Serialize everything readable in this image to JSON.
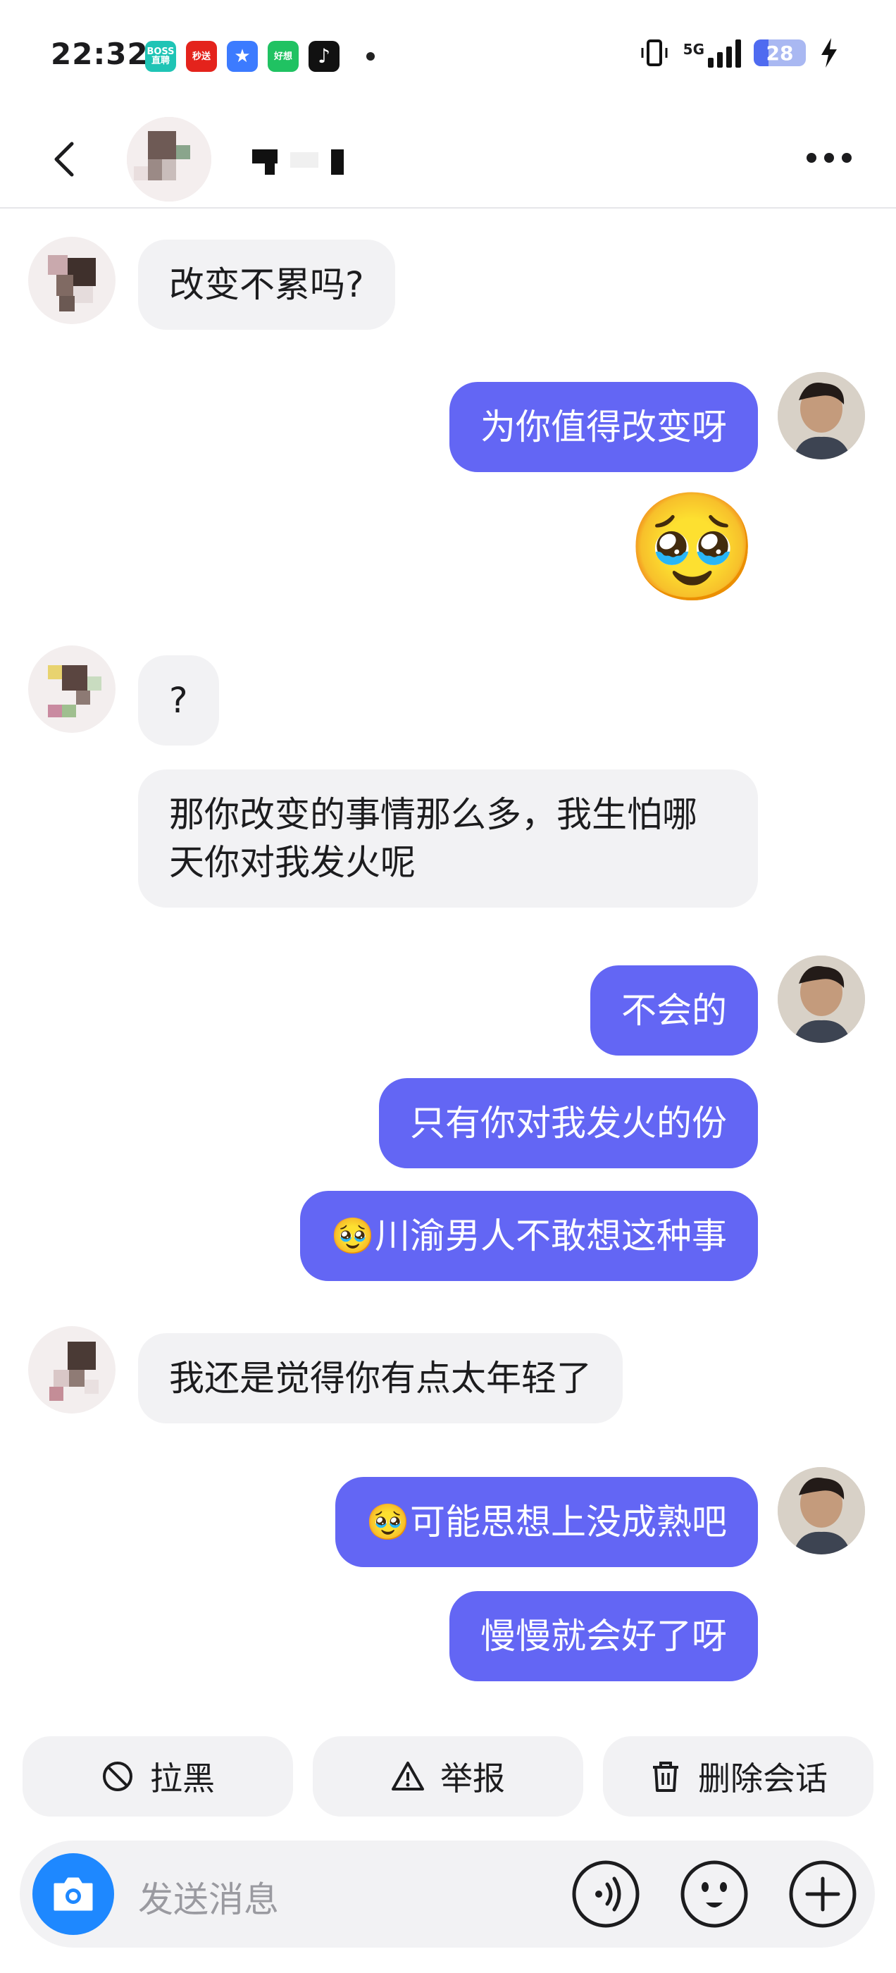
{
  "status_bar": {
    "time": "22:32",
    "network": "5G",
    "battery": "28",
    "battery_level": 0.28,
    "apps": [
      {
        "icon": "boss-zhipin-icon",
        "label": "BOSS直聘",
        "color": "#1fc4b5"
      },
      {
        "icon": "miaosong-icon",
        "label": "秒送",
        "color": "#e4231c"
      },
      {
        "icon": "star-app-icon",
        "label": "",
        "color": "#3c7bff"
      },
      {
        "icon": "haoxiang-icon",
        "label": "好想",
        "color": "#20c262"
      },
      {
        "icon": "douyin-icon",
        "label": "",
        "color": "#111111"
      }
    ]
  },
  "header": {
    "back_icon": "chevron-left-icon",
    "more_icon": "more-dots-icon"
  },
  "messages": [
    {
      "side": "in",
      "text": "改变不累吗?"
    },
    {
      "side": "out",
      "text": "为你值得改变呀"
    },
    {
      "side": "out",
      "emoji": "🥹",
      "text": ""
    },
    {
      "side": "in",
      "text": "?"
    },
    {
      "side": "in",
      "text": "那你改变的事情那么多，我生怕哪天你对我发火呢"
    },
    {
      "side": "out",
      "text": "不会的"
    },
    {
      "side": "out",
      "text": "只有你对我发火的份"
    },
    {
      "side": "out",
      "text": "🥹川渝男人不敢想这种事"
    },
    {
      "side": "in",
      "text": "我还是觉得你有点太年轻了"
    },
    {
      "side": "out",
      "text": "🥹可能思想上没成熟吧"
    },
    {
      "side": "out",
      "text": "慢慢就会好了呀"
    }
  ],
  "actions": {
    "block": {
      "label": "拉黑",
      "icon": "block-icon"
    },
    "report": {
      "label": "举报",
      "icon": "warning-icon"
    },
    "delete": {
      "label": "删除会话",
      "icon": "trash-icon"
    }
  },
  "input": {
    "placeholder": "发送消息",
    "camera_icon": "camera-icon",
    "voice_icon": "voice-icon",
    "emoji_icon": "emoji-icon",
    "plus_icon": "plus-icon"
  },
  "colors": {
    "outgoing_bubble": "#6366f4",
    "incoming_bubble": "#f2f2f4",
    "camera_button": "#1e88ff"
  }
}
